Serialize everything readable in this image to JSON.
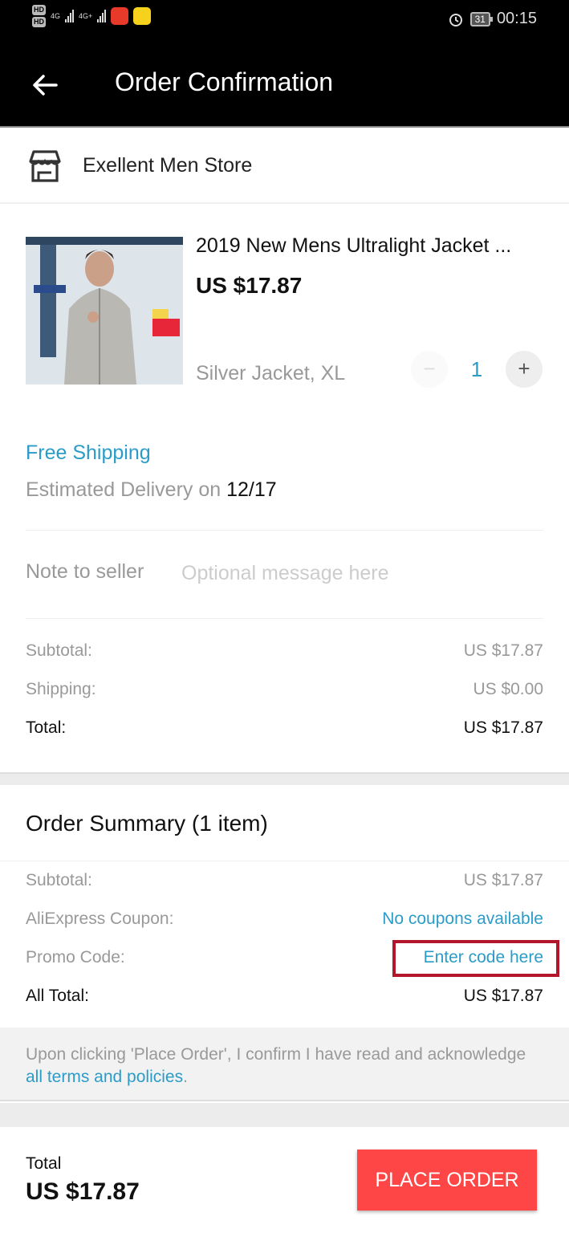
{
  "status_bar": {
    "sim1": "HD",
    "sim2": "HD",
    "net1": "4G",
    "net2": "4G+",
    "battery": "31",
    "time": "00:15",
    "icons": [
      "hd-icon",
      "signal-icon",
      "aliexpress-app-icon",
      "music-app-icon",
      "alarm-icon",
      "battery-icon"
    ]
  },
  "header": {
    "title": "Order Confirmation",
    "back_icon": "arrow-left-icon"
  },
  "store": {
    "icon": "store-icon",
    "name": "Exellent Men Store"
  },
  "product": {
    "title": "2019 New Mens Ultralight Jacket ...",
    "price": "US $17.87",
    "variant": "Silver Jacket, XL",
    "quantity": "1",
    "minus_label": "−",
    "plus_label": "+"
  },
  "shipping": {
    "method": "Free Shipping",
    "delivery_prefix": "Estimated Delivery on ",
    "delivery_date": "12/17"
  },
  "note": {
    "label": "Note to seller",
    "value": "",
    "placeholder": "Optional message here"
  },
  "store_totals": [
    {
      "label": "Subtotal:",
      "value": "US $17.87"
    },
    {
      "label": "Shipping:",
      "value": "US $0.00"
    },
    {
      "label": "Total:",
      "value": "US $17.87"
    }
  ],
  "order_summary": {
    "title": "Order Summary (1 item)",
    "rows": [
      {
        "label": "Subtotal:",
        "value": "US $17.87"
      },
      {
        "label": "AliExpress Coupon:",
        "value": "No coupons available"
      },
      {
        "label": "Promo Code:",
        "value": "Enter code here"
      },
      {
        "label": "All Total:",
        "value": "US $17.87"
      }
    ]
  },
  "terms": {
    "text": "Upon clicking 'Place Order', I confirm I have read and acknowledge ",
    "link": "all terms and policies",
    "suffix": "."
  },
  "footer": {
    "total_label": "Total",
    "total_value": "US $17.87",
    "place_order": "PLACE ORDER"
  },
  "colors": {
    "accent_blue": "#2b9cc8",
    "place_order_red": "#fe4646",
    "highlight_box": "#b3152a"
  }
}
